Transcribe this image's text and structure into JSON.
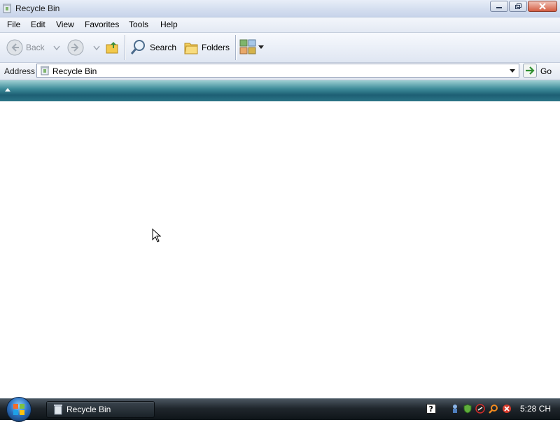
{
  "window": {
    "title": "Recycle Bin",
    "controls": [
      "minimize",
      "maximize",
      "close"
    ]
  },
  "menu": {
    "items": [
      "File",
      "Edit",
      "View",
      "Favorites",
      "Tools",
      "Help"
    ]
  },
  "toolbar": {
    "back_label": "Back",
    "search_label": "Search",
    "folders_label": "Folders",
    "icons": [
      "back-arrow-icon",
      "forward-arrow-icon",
      "up-folder-icon",
      "search-icon",
      "folders-icon",
      "views-icon"
    ]
  },
  "address": {
    "label": "Address",
    "value": "Recycle Bin",
    "go_label": "Go"
  },
  "taskbar": {
    "task_label": "Recycle Bin",
    "clock": "5:28 CH"
  },
  "colors": {
    "band_dark": "#1d5f74",
    "band_light": "#9fd0d3",
    "taskbar": "#1f262c"
  }
}
